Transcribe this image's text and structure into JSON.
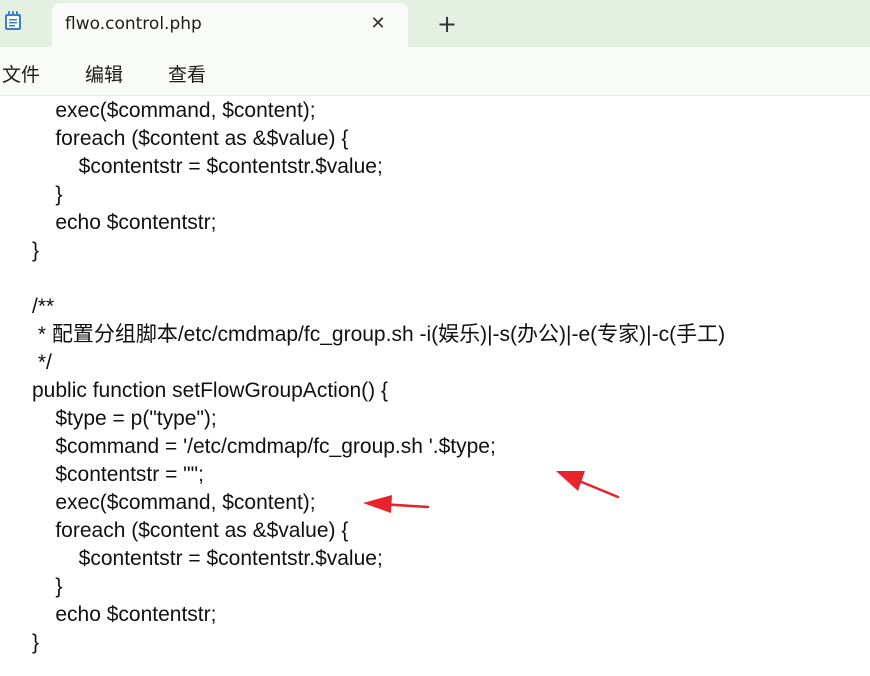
{
  "tab": {
    "title": "flwo.control.php",
    "close_icon": "close-icon",
    "new_tab_icon": "plus-icon"
  },
  "menu": {
    "items": [
      "文件",
      "编辑",
      "查看"
    ]
  },
  "editor": {
    "lines": [
      "    exec($command, $content);",
      "    foreach ($content as &$value) {",
      "        $contentstr = $contentstr.$value;",
      "    }",
      "    echo $contentstr;",
      "}",
      "",
      "/**",
      " * 配置分组脚本/etc/cmdmap/fc_group.sh -i(娱乐)|-s(办公)|-e(专家)|-c(手工)",
      " */",
      "public function setFlowGroupAction() {",
      "    $type = p(\"type\");",
      "    $command = '/etc/cmdmap/fc_group.sh '.$type;",
      "    $contentstr = \"\";",
      "    exec($command, $content);",
      "    foreach ($content as &$value) {",
      "        $contentstr = $contentstr.$value;",
      "    }",
      "    echo $contentstr;",
      "}"
    ]
  },
  "annotation_color": "#e8242a",
  "titlebar_color": "#e4f0e1"
}
